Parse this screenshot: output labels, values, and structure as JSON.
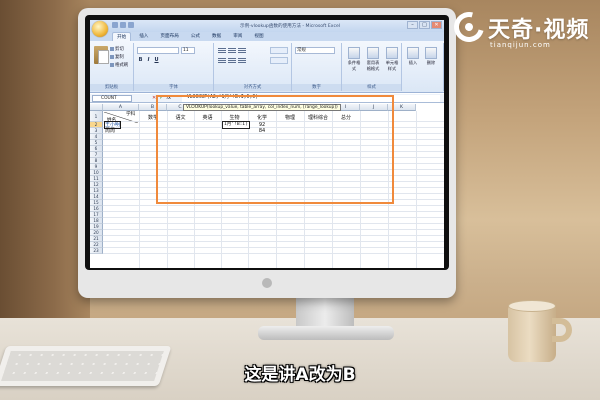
{
  "window": {
    "title": "示例-vlookup函数的使用方法 - Microsoft Excel",
    "controls": [
      "–",
      "□",
      "✕"
    ]
  },
  "tabs": [
    {
      "label": "开始",
      "active": true
    },
    {
      "label": "插入"
    },
    {
      "label": "页面布局"
    },
    {
      "label": "公式"
    },
    {
      "label": "数据"
    },
    {
      "label": "审阅"
    },
    {
      "label": "视图"
    }
  ],
  "ribbon": {
    "clipboard": {
      "cut": "剪切",
      "copy": "复制",
      "format_painter": "格式刷",
      "label": "剪贴板"
    },
    "font": {
      "name": "",
      "size": "11",
      "label": "字体",
      "buttons": [
        "B",
        "I",
        "U"
      ]
    },
    "alignment": {
      "label": "对齐方式"
    },
    "number": {
      "format": "常规",
      "label": "数字"
    },
    "styles": {
      "label": "样式",
      "buttons": [
        "条件格式",
        "套用表格格式",
        "单元格样式"
      ]
    },
    "cells": {
      "buttons": [
        "插入",
        "删除",
        "格式"
      ]
    }
  },
  "formula_bar": {
    "name_box": "COUNT",
    "fx_icons": [
      "✕",
      "✓",
      "fx"
    ],
    "formula": "=VLOOKUP(A2,'1月'!B:I,6,0)",
    "tooltip": "VLOOKUP(lookup_value, table_array, col_index_num, [range_lookup])"
  },
  "grid": {
    "columns": [
      "A",
      "B",
      "C",
      "D",
      "E",
      "F",
      "G",
      "H",
      "I",
      "J",
      "K"
    ],
    "rows": [
      "1",
      "2",
      "3",
      "4",
      "5",
      "6",
      "7",
      "8",
      "9",
      "10",
      "11",
      "12",
      "13",
      "14",
      "15",
      "16",
      "17",
      "18",
      "19",
      "20",
      "21",
      "22",
      "23"
    ],
    "header_corner": {
      "top": "学科",
      "bottom": "姓名"
    },
    "headers": [
      "数学",
      "语文",
      "英语",
      "生物",
      "化学",
      "物理",
      "理科综合",
      "总分"
    ],
    "names": [
      "王小明",
      "周周"
    ],
    "editing_cell": "1月'!B:I)",
    "values": {
      "chem": [
        "92",
        "84"
      ]
    }
  },
  "watermark": {
    "brand": "天奇·视频",
    "url": "tianqijun.com"
  },
  "caption": "这是讲A改为B"
}
